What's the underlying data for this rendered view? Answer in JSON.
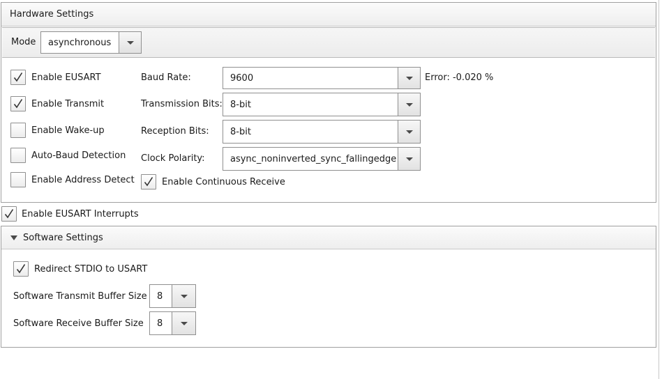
{
  "hardware": {
    "title": "Hardware Settings",
    "mode_label": "Mode",
    "mode_value": "asynchronous",
    "checkboxes": [
      {
        "label": "Enable EUSART",
        "checked": true
      },
      {
        "label": "Enable Transmit",
        "checked": true
      },
      {
        "label": "Enable Wake-up",
        "checked": false
      },
      {
        "label": "Auto-Baud Detection",
        "checked": false
      },
      {
        "label": "Enable Address Detect",
        "checked": false
      }
    ],
    "baud_rate": {
      "label": "Baud Rate:",
      "value": "9600",
      "error": "Error: -0.020 %"
    },
    "transmission_bits": {
      "label": "Transmission Bits:",
      "value": "8-bit"
    },
    "reception_bits": {
      "label": "Reception Bits:",
      "value": "8-bit"
    },
    "clock_polarity": {
      "label": "Clock Polarity:",
      "value": "async_noninverted_sync_fallingedge"
    },
    "continuous_receive": {
      "label": "Enable Continuous Receive",
      "checked": true
    }
  },
  "interrupts": {
    "label": "Enable EUSART Interrupts",
    "checked": true
  },
  "software": {
    "title": "Software Settings",
    "redirect_stdio": {
      "label": "Redirect STDIO to USART",
      "checked": true
    },
    "tx_buffer": {
      "label": "Software Transmit Buffer Size",
      "value": "8"
    },
    "rx_buffer": {
      "label": "Software Receive Buffer Size",
      "value": "8"
    }
  },
  "icons": {
    "check": "checkmark-icon",
    "dropdown": "chevron-down-icon",
    "collapse": "triangle-down-icon"
  }
}
